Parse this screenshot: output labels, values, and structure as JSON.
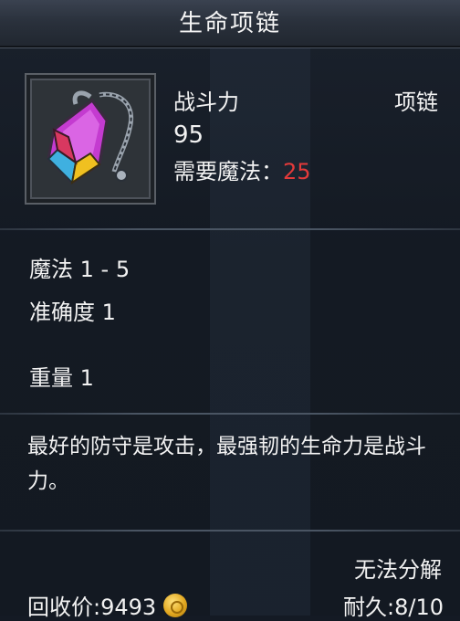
{
  "window": {
    "title": "生命项链"
  },
  "item": {
    "icon": "necklace-icon",
    "power_label": "战斗力",
    "power_value": "95",
    "requirement_label": "需要魔法：",
    "requirement_value": "25",
    "type": "项链"
  },
  "attributes": [
    "魔法 1 - 5",
    "准确度 1",
    "重量 1"
  ],
  "description": "最好的防守是攻击，最强韧的生命力是战斗力。",
  "footer": {
    "cannot_decompose": "无法分解",
    "sell_price": "回收价:9493",
    "durability": "耐久:8/10"
  },
  "colors": {
    "requirement_value": "#e43a3a",
    "text": "#f2f2f2"
  }
}
